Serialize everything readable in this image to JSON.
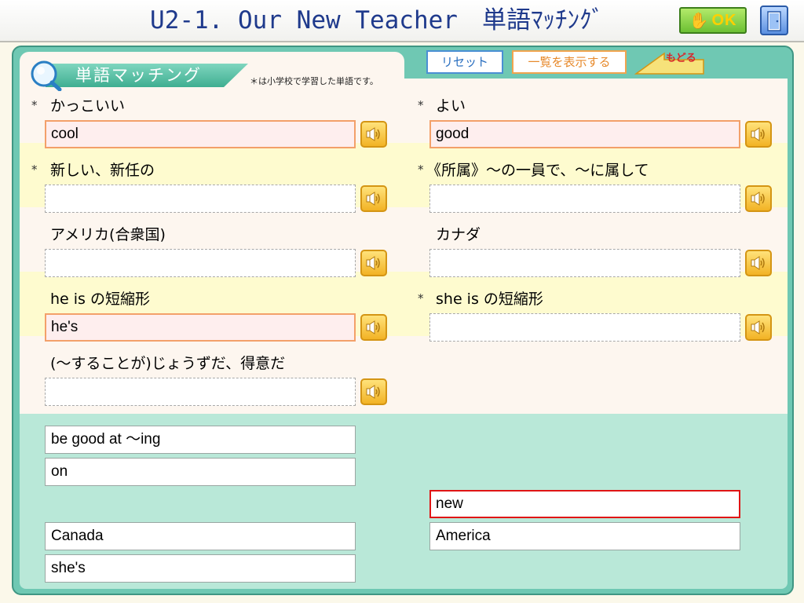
{
  "header": {
    "title": "U2-1. Our New Teacher　単語ﾏｯﾁﾝｸﾞ",
    "ok_label": "OK"
  },
  "toolbar": {
    "section_title": "単語マッチング",
    "note": "＊は小学校で学習した単語です。",
    "reset_label": "リセット",
    "show_list_label": "一覧を表示する",
    "back_label": "もどる"
  },
  "items": [
    {
      "mark": "*",
      "label": "かっこいい",
      "answer": "cool"
    },
    {
      "mark": "*",
      "label": "よい",
      "answer": "good"
    },
    {
      "mark": "*",
      "label": "新しい、新任の",
      "answer": ""
    },
    {
      "mark": "*",
      "label": "《所属》〜の一員で、〜に属して",
      "answer": ""
    },
    {
      "mark": "",
      "label": "アメリカ(合衆国)",
      "answer": ""
    },
    {
      "mark": "",
      "label": "カナダ",
      "answer": ""
    },
    {
      "mark": "",
      "label": "he is の短縮形",
      "answer": "he's"
    },
    {
      "mark": "*",
      "label": "she is の短縮形",
      "answer": ""
    },
    {
      "mark": "",
      "label": "(〜することが)じょうずだ、得意だ",
      "answer": ""
    }
  ],
  "word_bank": [
    {
      "text": "be good at 〜ing",
      "selected": false
    },
    {
      "text": "on",
      "selected": false
    },
    {
      "text": "Canada",
      "selected": false
    },
    {
      "text": "she's",
      "selected": false
    },
    {
      "text": "new",
      "selected": true
    },
    {
      "text": "America",
      "selected": false
    }
  ],
  "colors": {
    "frame": "#6fc8b3",
    "row_cream": "#fdf6ef",
    "row_yellow": "#fefbcf",
    "bank_bg": "#b9e8d8",
    "title_blue": "#1f3a8c",
    "filled_border": "#f3a06a",
    "selected_border": "#e01515"
  },
  "icons": {
    "ok": "hand-ok-icon",
    "exit": "door-exit-icon",
    "search": "magnifier-icon",
    "back": "back-arrow-icon",
    "audio": "speaker-icon"
  }
}
